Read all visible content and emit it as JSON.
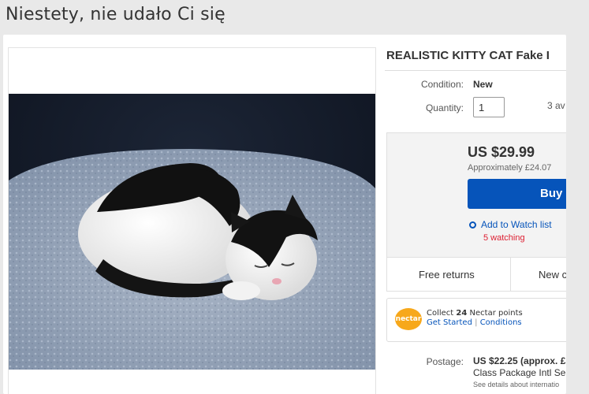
{
  "page": {
    "title": "Niestety, nie udało Ci się"
  },
  "listing": {
    "title": "REALISTIC KITTY CAT Fake I",
    "condition_label": "Condition:",
    "condition_value": "New",
    "quantity_label": "Quantity:",
    "quantity_value": "1",
    "available_text": "3 av",
    "price": "US $29.99",
    "approx_price": "Approximately £24.07",
    "buy_label": "Buy",
    "watch_label": "Add to Watch list",
    "watching_text": "5 watching",
    "free_returns": "Free returns",
    "new_condition_cell": "New c",
    "nectar": {
      "logo_text": "nectar",
      "collect_prefix": "Collect",
      "points": "24",
      "collect_suffix": "Nectar points",
      "get_started": "Get Started",
      "separator": "|",
      "conditions": "Conditions"
    },
    "postage_label": "Postage:",
    "postage_value": "US $22.25 (approx. £1",
    "postage_line2": "Class Package Intl Se",
    "postage_line3": "See details about internatio"
  },
  "icons": {
    "watch": "circle-eye-icon"
  },
  "colors": {
    "link": "#0654ba",
    "buy_button": "#0654ba",
    "watching": "#dd1e31",
    "nectar": "#f7a81b"
  }
}
